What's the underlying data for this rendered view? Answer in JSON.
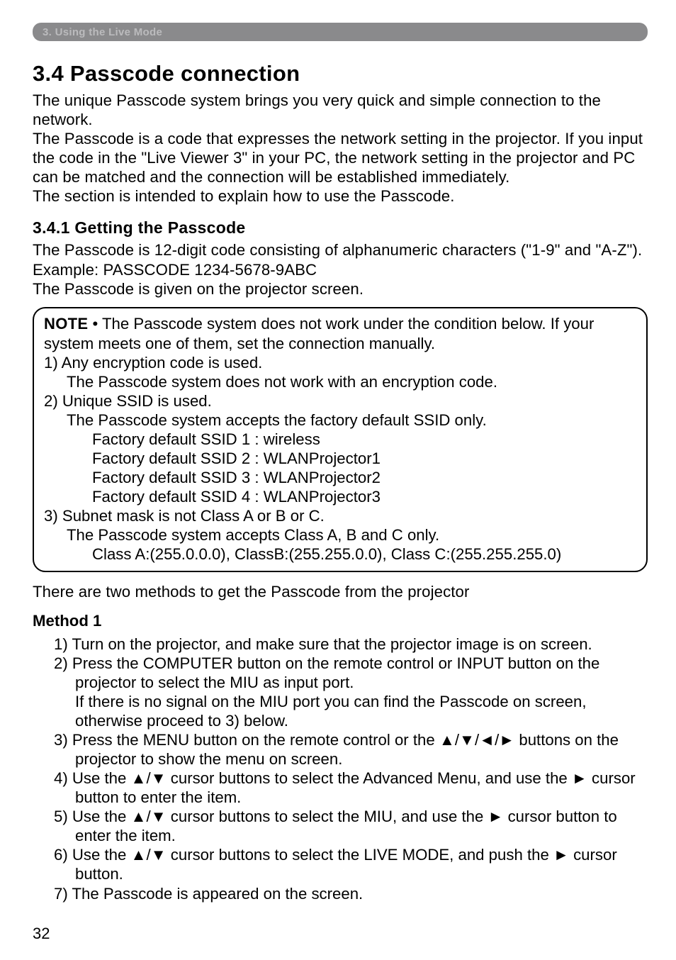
{
  "crumb": "3. Using the Live Mode",
  "title": "3.4 Passcode connection",
  "intro": {
    "p1": "The unique Passcode system brings you very quick and simple connection to the network.",
    "p2": "The Passcode is a code that expresses the network setting in the projector. If you input the code in the \"Live Viewer 3\" in your PC, the network setting in the projector and PC can be matched and the connection will be established immediately.",
    "p3": "The section is intended to explain how to use the Passcode."
  },
  "sub_title": "3.4.1 Getting the Passcode",
  "sub_intro": {
    "p1": "The Passcode is 12-digit code consisting of alphanumeric characters (\"1-9\" and \"A-Z\"). Example: PASSCODE 1234-5678-9ABC",
    "p2": "The Passcode is given on the projector screen."
  },
  "note": {
    "label": "NOTE",
    "lead": " • The Passcode system does not work under the condition below. If your system meets one of them, set the connection manually.",
    "i1": "1) Any encryption code is used.",
    "i1_a": "The Passcode system does not work with an encryption code.",
    "i2": "2) Unique SSID is used.",
    "i2_a": "The Passcode system accepts the factory default SSID only.",
    "i2_b": "Factory default SSID 1 : wireless",
    "i2_c": "Factory default SSID 2 : WLANProjector1",
    "i2_d": "Factory default SSID 3 : WLANProjector2",
    "i2_e": "Factory default SSID 4 : WLANProjector3",
    "i3": "3) Subnet mask is not Class A or B or C.",
    "i3_a": "The Passcode system accepts Class A, B and C only.",
    "i3_b": "Class A:(255.0.0.0), ClassB:(255.255.0.0), Class C:(255.255.255.0)"
  },
  "two_methods": "There are two methods to get the Passcode from the projector",
  "method1": {
    "heading": "Method 1",
    "s1": "1) Turn on the projector, and make sure that the projector image is on screen.",
    "s2": "2) Press the COMPUTER button on the remote control or INPUT button on the projector to select the MIU as input port.",
    "s2_a": "If there is no signal on the MIU port you can find the Passcode on screen, otherwise proceed to 3) below.",
    "s3": "3) Press the MENU button on the remote control or the ▲/▼/◄/► buttons on the projector to show the menu on screen.",
    "s4": "4) Use the ▲/▼ cursor buttons to select the Advanced Menu, and use the ► cursor button to enter the item.",
    "s5": "5) Use the ▲/▼ cursor buttons to select the MIU, and use the ► cursor button to enter the item.",
    "s6": "6) Use the ▲/▼ cursor buttons to select the LIVE MODE, and push the ► cursor button.",
    "s7": "7) The Passcode is appeared on the screen."
  },
  "page_number": "32"
}
